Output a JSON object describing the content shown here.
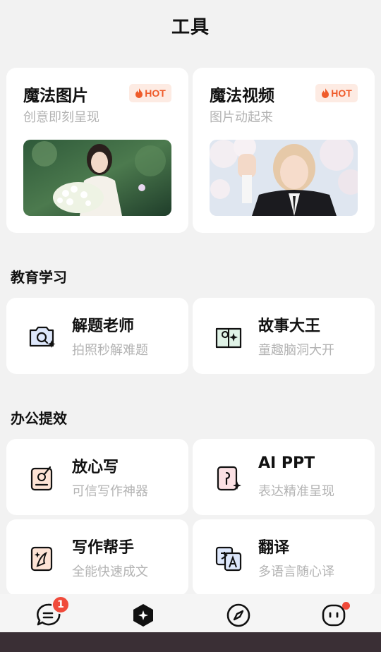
{
  "page": {
    "title": "工具"
  },
  "featured": [
    {
      "title": "魔法图片",
      "subtitle": "创意即刻呈现",
      "badge": "HOT",
      "image": "bride-holding-flowers-photo"
    },
    {
      "title": "魔法视频",
      "subtitle": "图片动起来",
      "badge": "HOT",
      "image": "girl-waving-under-blossoms-photo"
    }
  ],
  "sections": {
    "education": {
      "title": "教育学习",
      "items": [
        {
          "name": "解题老师",
          "desc": "拍照秒解难题",
          "icon": "camera-sparkle-icon"
        },
        {
          "name": "故事大王",
          "desc": "童趣脑洞大开",
          "icon": "book-sparkle-icon"
        }
      ]
    },
    "office": {
      "title": "办公提效",
      "items": [
        {
          "name": "放心写",
          "desc": "可信写作神器",
          "icon": "pen-doc-icon"
        },
        {
          "name": "AI PPT",
          "desc": "表达精准呈现",
          "icon": "slide-sparkle-icon"
        },
        {
          "name": "写作帮手",
          "desc": "全能快速成文",
          "icon": "write-sparkle-icon"
        },
        {
          "name": "翻译",
          "desc": "多语言随心译",
          "icon": "translate-icon"
        }
      ]
    }
  },
  "tabbar": {
    "items": [
      {
        "label": "对话",
        "icon": "chat-icon",
        "badge": "1"
      },
      {
        "label": "工具",
        "icon": "tools-icon",
        "active": true
      },
      {
        "label": "发现",
        "icon": "compass-icon"
      },
      {
        "label": "",
        "icon": "profile-face-icon",
        "dot": true
      }
    ]
  },
  "colors": {
    "hot": "#ef5b2a",
    "hot_bg": "#fdebe3",
    "badge": "#f04a3a",
    "subtext": "#b3b3b3"
  }
}
